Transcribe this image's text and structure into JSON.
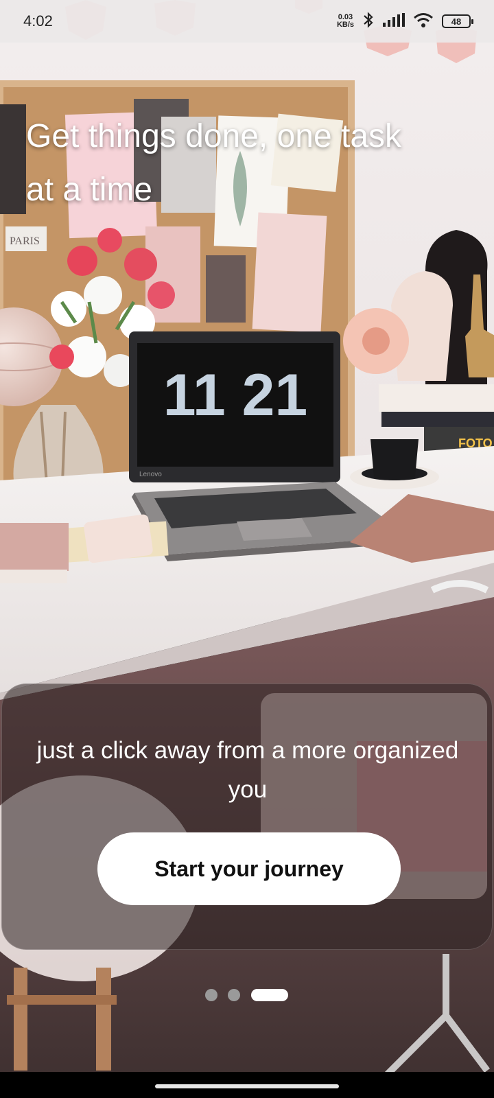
{
  "status_bar": {
    "time": "4:02",
    "net_speed_value": "0.03",
    "net_speed_unit": "KB/s",
    "battery_level": "48",
    "icons": [
      "bluetooth-icon",
      "signal-icon",
      "wifi-icon",
      "battery-icon"
    ]
  },
  "hero": {
    "headline": "Get things done, one task at a time"
  },
  "card": {
    "subtitle": "just a click away from a more organized you",
    "cta_label": "Start your journey"
  },
  "background_screen": {
    "time_display": "11 21",
    "laptop_brand": "Lenovo",
    "postcard_text": "PARIS"
  },
  "pager": {
    "count": 3,
    "active_index": 2
  },
  "colors": {
    "cta_background": "#ffffff",
    "cta_text": "#111111",
    "card_overlay": "rgba(45,35,35,0.55)",
    "active_dot": "#ffffff",
    "inactive_dot": "#9a9a9a"
  }
}
